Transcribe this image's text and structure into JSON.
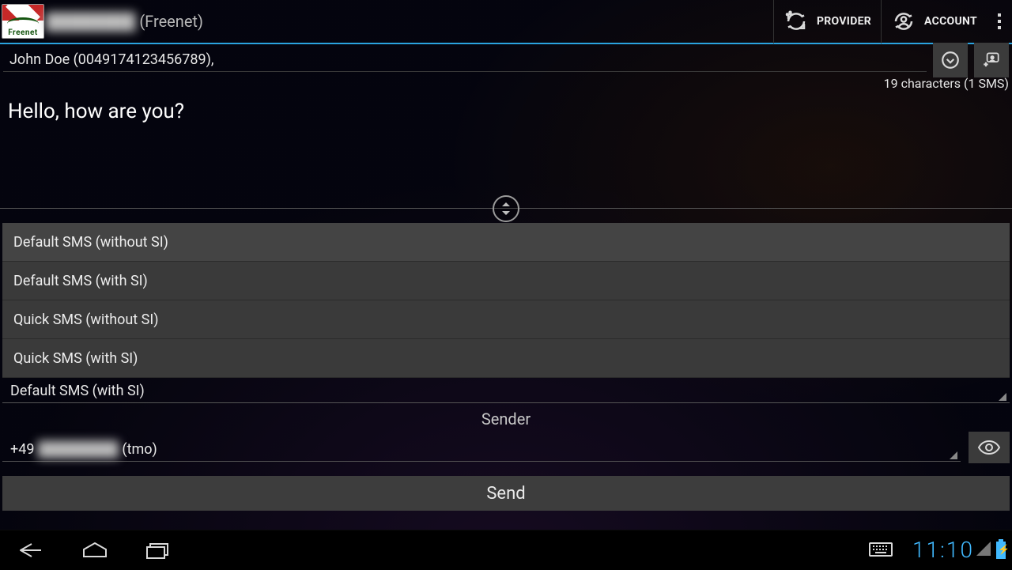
{
  "actionbar": {
    "title_masked": "████████",
    "title_suffix": "(Freenet)",
    "provider_label": "PROVIDER",
    "account_label": "ACCOUNT"
  },
  "recipients": {
    "value": "John Doe (0049174123456789),"
  },
  "counter": "19 characters (1 SMS)",
  "message_text": "Hello, how are you?",
  "options": [
    "Default SMS (without SI)",
    "Default SMS (with SI)",
    "Quick SMS (without SI)",
    "Quick SMS (with SI)"
  ],
  "selected_option": "Default SMS (with SI)",
  "sender_label": "Sender",
  "sender_value_prefix": "+49",
  "sender_value_masked": "████████",
  "sender_value_suffix": "(tmo)",
  "send_label": "Send",
  "statusbar": {
    "time": "11:10"
  }
}
